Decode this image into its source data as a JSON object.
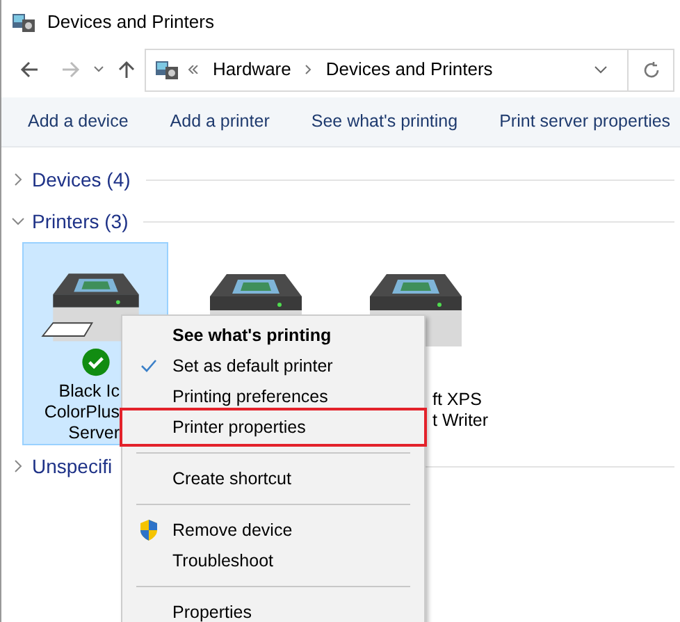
{
  "window": {
    "title": "Devices and Printers"
  },
  "address": {
    "back_disabled": false,
    "forward_disabled": true,
    "crumbs": [
      "Hardware",
      "Devices and Printers"
    ]
  },
  "commands": [
    "Add a device",
    "Add a printer",
    "See what's printing",
    "Print server properties"
  ],
  "groups": [
    {
      "label": "Devices (4)",
      "expanded": false
    },
    {
      "label": "Printers (3)",
      "expanded": true,
      "tiles": [
        {
          "lines": [
            "Black Ic",
            "ColorPlus",
            "Server"
          ],
          "selected": true,
          "default": true
        },
        {
          "selected": false
        },
        {
          "lines": [
            "ft XPS",
            "t Writer"
          ],
          "selected": false
        }
      ]
    },
    {
      "label": "Unspecifi",
      "expanded": false
    }
  ],
  "menu": [
    {
      "kind": "item",
      "label": "See what's printing",
      "bold": true,
      "checked": false,
      "selected": false
    },
    {
      "kind": "item",
      "label": "Set as default printer",
      "bold": false,
      "checked": true,
      "selected": false
    },
    {
      "kind": "item",
      "label": "Printing preferences",
      "bold": false,
      "checked": false,
      "selected": false
    },
    {
      "kind": "item",
      "label": "Printer properties",
      "bold": false,
      "checked": false,
      "selected": true
    },
    {
      "kind": "separator"
    },
    {
      "kind": "item",
      "label": "Create shortcut",
      "bold": false,
      "checked": false,
      "selected": false
    },
    {
      "kind": "separator"
    },
    {
      "kind": "elevated",
      "label": "Remove device",
      "bold": false,
      "checked": false,
      "selected": false
    },
    {
      "kind": "item",
      "label": "Troubleshoot",
      "bold": false,
      "checked": false,
      "selected": false
    },
    {
      "kind": "separator"
    },
    {
      "kind": "item",
      "label": "Properties",
      "bold": false,
      "checked": false,
      "selected": false
    }
  ]
}
